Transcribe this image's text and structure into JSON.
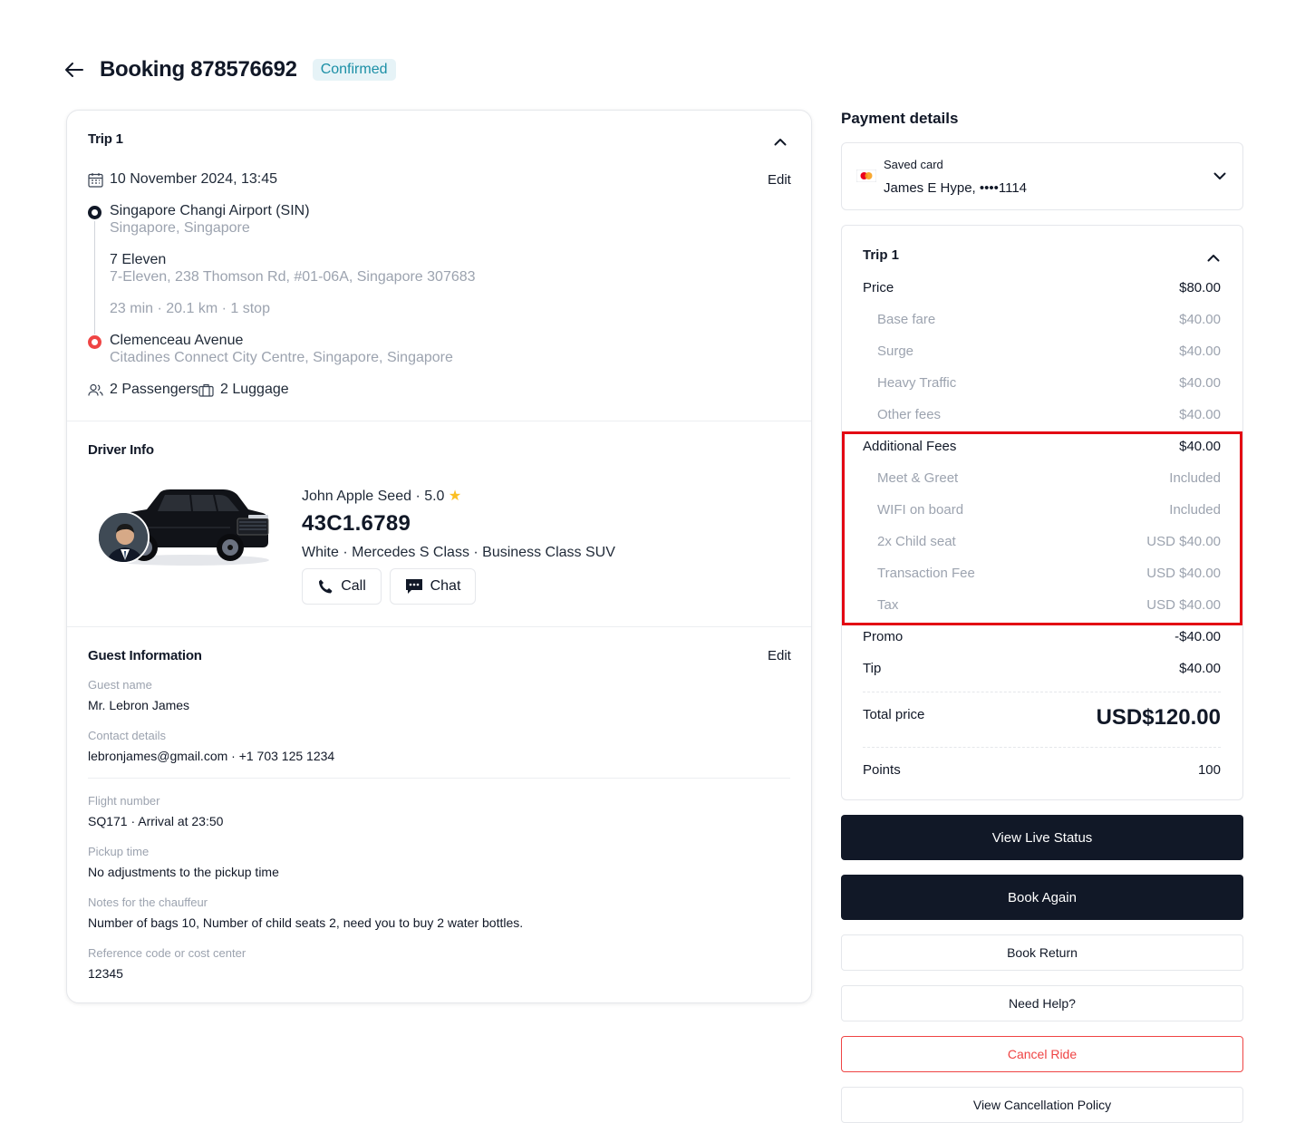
{
  "header": {
    "title": "Booking 878576692",
    "status": "Confirmed"
  },
  "trip": {
    "title": "Trip 1",
    "datetime": "10 November 2024, 13:45",
    "edit_label": "Edit",
    "origin": {
      "name": "Singapore Changi Airport (SIN)",
      "subtitle": "Singapore, Singapore"
    },
    "stop": {
      "name": "7 Eleven",
      "subtitle": "7-Eleven, 238 Thomson Rd, #01-06A, Singapore 307683"
    },
    "summary": "23 min · 20.1 km · 1 stop",
    "destination": {
      "name": "Clemenceau Avenue",
      "subtitle": "Citadines Connect City Centre, Singapore, Singapore"
    },
    "passengers": "2 Passengers",
    "luggage": "2 Luggage"
  },
  "driver": {
    "title": "Driver Info",
    "name_rating": "John Apple Seed · 5.0",
    "plate": "43C1.6789",
    "vehicle": "White · Mercedes S Class · Business Class SUV",
    "call_label": "Call",
    "chat_label": "Chat"
  },
  "guest": {
    "title": "Guest Information",
    "edit_label": "Edit",
    "name_label": "Guest name",
    "name": "Mr. Lebron James",
    "contact_label": "Contact details",
    "contact": "lebronjames@gmail.com · +1 703 125 1234",
    "flight_label": "Flight number",
    "flight": "SQ171 · Arrival at 23:50",
    "pickup_label": "Pickup time",
    "pickup": "No adjustments to the pickup time",
    "notes_label": "Notes for the chauffeur",
    "notes": "Number of bags 10, Number of child seats 2, need you to buy 2 water bottles.",
    "ref_label": "Reference code or cost center",
    "ref": "12345"
  },
  "payment": {
    "title": "Payment details",
    "card_label": "Saved card",
    "card_value": "James E Hype, ••••1114",
    "trip_title": "Trip 1",
    "price_label": "Price",
    "price": "$80.00",
    "price_items": [
      {
        "label": "Base fare",
        "value": "$40.00"
      },
      {
        "label": "Surge",
        "value": "$40.00"
      },
      {
        "label": "Heavy Traffic",
        "value": "$40.00"
      },
      {
        "label": "Other fees",
        "value": "$40.00"
      }
    ],
    "additional_label": "Additional Fees",
    "additional": "$40.00",
    "additional_items": [
      {
        "label": "Meet & Greet",
        "value": "Included"
      },
      {
        "label": "WIFI on board",
        "value": "Included"
      },
      {
        "label": "2x Child seat",
        "value": "USD $40.00"
      },
      {
        "label": "Transaction Fee",
        "value": "USD $40.00"
      },
      {
        "label": "Tax",
        "value": "USD $40.00"
      }
    ],
    "promo_label": "Promo",
    "promo": "-$40.00",
    "tip_label": "Tip",
    "tip": "$40.00",
    "total_label": "Total price",
    "total": "USD$120.00",
    "points_label": "Points",
    "points": "100"
  },
  "actions": {
    "live_status": "View Live Status",
    "book_again": "Book Again",
    "book_return": "Book Return",
    "need_help": "Need Help?",
    "cancel_ride": "Cancel Ride",
    "cancellation_policy": "View Cancellation Policy"
  },
  "colors": {
    "primary_dark": "#111827",
    "status_text": "#1b8fa6",
    "status_bg": "#e6f3f7",
    "danger": "#ef4444",
    "highlight": "#e30613"
  }
}
